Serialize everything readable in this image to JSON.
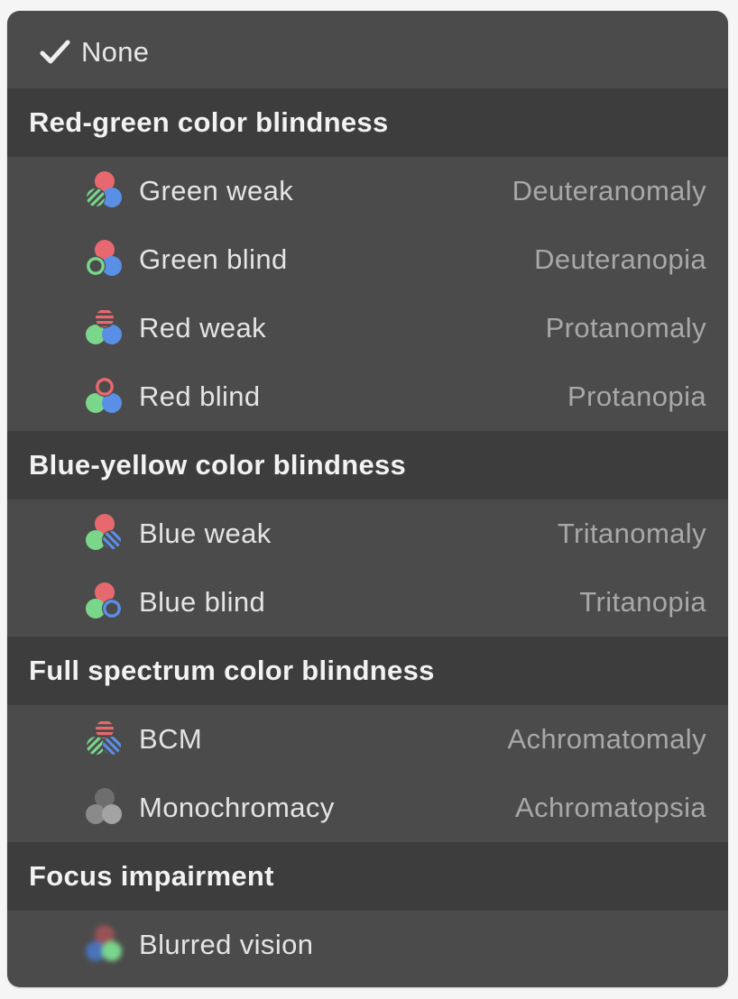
{
  "menu": {
    "none_item": {
      "label": "None",
      "checked": true,
      "icon": "checkmark-icon"
    },
    "sections": [
      {
        "title": "Red-green color blindness",
        "items": [
          {
            "label": "Green weak",
            "sublabel": "Deuteranomaly",
            "icon": "deuteranomaly-icon"
          },
          {
            "label": "Green blind",
            "sublabel": "Deuteranopia",
            "icon": "deuteranopia-icon"
          },
          {
            "label": "Red weak",
            "sublabel": "Protanomaly",
            "icon": "protanomaly-icon"
          },
          {
            "label": "Red blind",
            "sublabel": "Protanopia",
            "icon": "protanopia-icon"
          }
        ]
      },
      {
        "title": "Blue-yellow color blindness",
        "items": [
          {
            "label": "Blue weak",
            "sublabel": "Tritanomaly",
            "icon": "tritanomaly-icon"
          },
          {
            "label": "Blue blind",
            "sublabel": "Tritanopia",
            "icon": "tritanopia-icon"
          }
        ]
      },
      {
        "title": "Full spectrum color blindness",
        "items": [
          {
            "label": "BCM",
            "sublabel": "Achromatomaly",
            "icon": "achromatomaly-icon"
          },
          {
            "label": "Monochromacy",
            "sublabel": "Achromatopsia",
            "icon": "achromatopsia-icon"
          }
        ]
      },
      {
        "title": "Focus impairment",
        "items": [
          {
            "label": "Blurred vision",
            "sublabel": "",
            "icon": "blurred-vision-icon"
          }
        ]
      }
    ]
  },
  "colors": {
    "menu_background": "#4b4b4b",
    "section_background": "#3d3d3d",
    "red": "#e8686f",
    "green": "#7ad68a",
    "blue": "#5a8fe6",
    "gray": "#8a8a8a"
  }
}
